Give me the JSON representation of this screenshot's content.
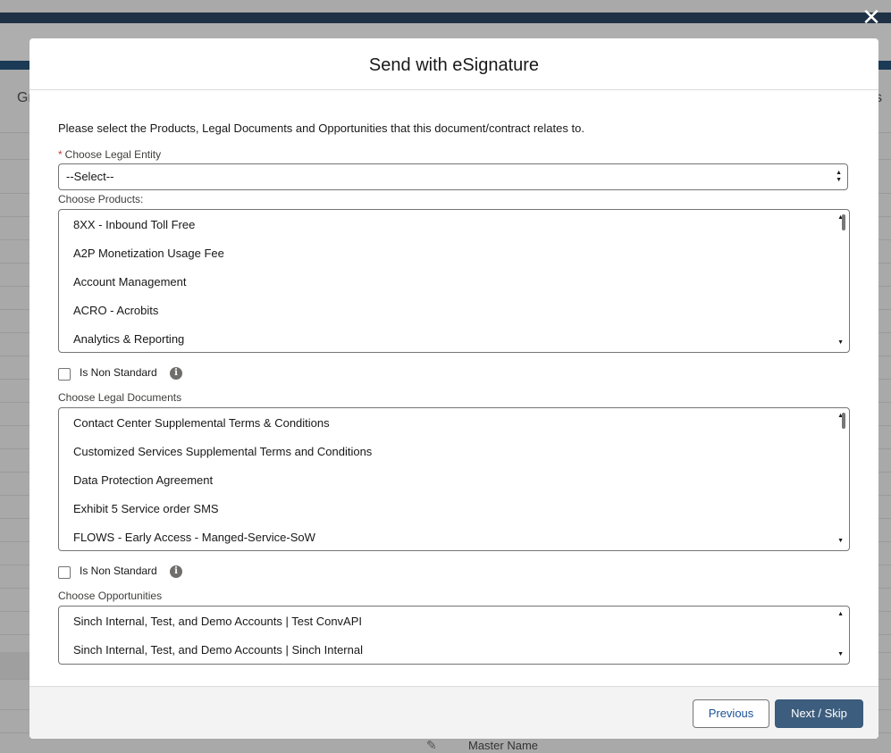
{
  "background": {
    "tab_left_fragment": "Gr",
    "tab_right_fragment": "s",
    "master_name_label": "Master Name",
    "pencil_icon": "pencil-icon"
  },
  "modal": {
    "close_icon": "close-icon",
    "title": "Send with eSignature",
    "intro": "Please select the Products, Legal Documents and Opportunities that this document/contract relates to.",
    "legal_entity": {
      "required_marker": "*",
      "label": "Choose Legal Entity",
      "value": "--Select--"
    },
    "products": {
      "label": "Choose Products:",
      "items": [
        "8XX - Inbound Toll Free",
        "A2P Monetization Usage Fee",
        "Account Management",
        "ACRO - Acrobits",
        "Analytics & Reporting"
      ],
      "non_standard_label": "Is Non Standard"
    },
    "legal_documents": {
      "label": "Choose Legal Documents",
      "items": [
        "Contact Center Supplemental Terms & Conditions",
        "Customized Services Supplemental Terms and Conditions",
        "Data Protection Agreement",
        "Exhibit 5 Service order SMS",
        "FLOWS - Early Access - Manged-Service-SoW"
      ],
      "non_standard_label": "Is Non Standard"
    },
    "opportunities": {
      "label": "Choose Opportunities",
      "items": [
        "Sinch Internal, Test, and Demo Accounts | Test ConvAPI",
        "Sinch Internal, Test, and Demo Accounts | Sinch Internal"
      ]
    },
    "footer": {
      "previous_label": "Previous",
      "next_label": "Next / Skip"
    }
  }
}
